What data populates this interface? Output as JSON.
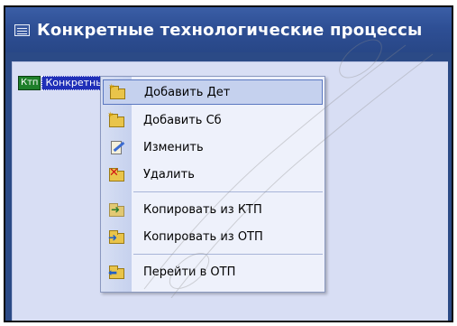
{
  "window": {
    "title": "Конкретные технологические процессы"
  },
  "tree": {
    "tag": "Ктп",
    "label": "Конкретные ТП"
  },
  "context_menu": {
    "items": [
      {
        "label": "Добавить Дет",
        "icon": "folder-star-icon",
        "highlighted": true
      },
      {
        "label": "Добавить Сб",
        "icon": "folder-star-icon",
        "highlighted": false
      },
      {
        "label": "Изменить",
        "icon": "edit-document-icon",
        "highlighted": false
      },
      {
        "label": "Удалить",
        "icon": "delete-icon",
        "highlighted": false
      },
      {
        "label": "Копировать из КТП",
        "icon": "copy-arrow-icon",
        "highlighted": false
      },
      {
        "label": "Копировать из ОТП",
        "icon": "copy-folder-icon",
        "highlighted": false
      },
      {
        "label": "Перейти в ОТП",
        "icon": "go-to-folder-icon",
        "highlighted": false
      }
    ]
  },
  "colors": {
    "title_bar": "#2e4f95",
    "client_area": "#d8def4",
    "menu_background": "#eef1fb",
    "menu_highlight": "#c5d1ee",
    "tree_selection": "#1f2fb8",
    "tag_green": "#1e7f2a"
  }
}
